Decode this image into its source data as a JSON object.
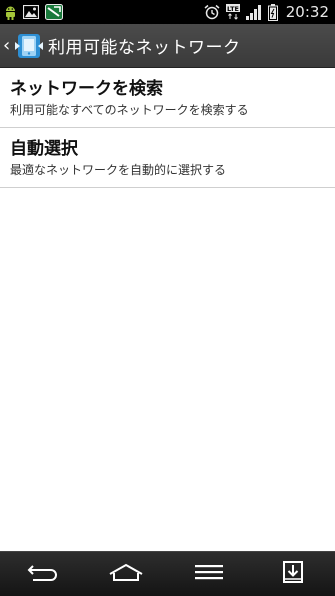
{
  "status_bar": {
    "time": "20:32",
    "network_type": "LTE",
    "battery_level": "full",
    "icons": [
      "android-notification-icon",
      "gallery-notification-icon",
      "app-notification-icon",
      "alarm-icon",
      "lte-icon",
      "signal-icon",
      "battery-icon"
    ]
  },
  "action_bar": {
    "back_glyph": "‹",
    "title": "利用可能なネットワーク",
    "icon": "network-settings-icon"
  },
  "preferences": [
    {
      "title": "ネットワークを検索",
      "summary": "利用可能なすべてのネットワークを検索する"
    },
    {
      "title": "自動選択",
      "summary": "最適なネットワークを自動的に選択する"
    }
  ],
  "nav_bar": {
    "buttons": [
      "back-icon",
      "home-icon",
      "menu-icon",
      "notification-pull-icon"
    ]
  }
}
